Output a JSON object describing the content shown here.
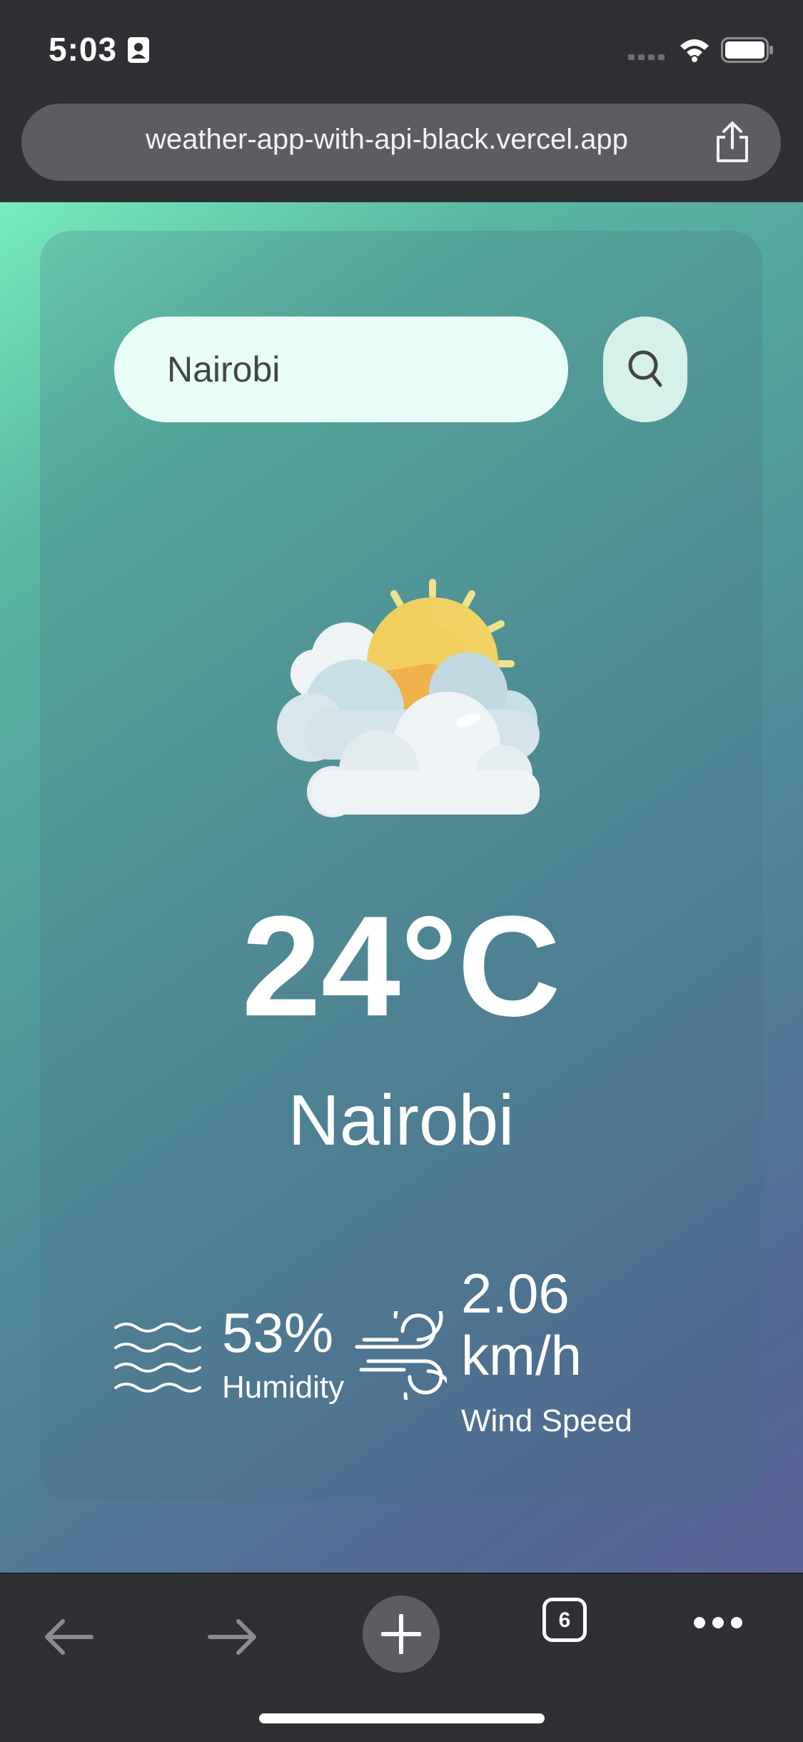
{
  "status_bar": {
    "time": "5:03",
    "icons": [
      "contact-card-icon",
      "cellular-signal-icon",
      "wifi-icon",
      "battery-icon"
    ]
  },
  "browser": {
    "url": "weather-app-with-api-black.vercel.app",
    "share_icon": "share-icon",
    "tab_count": "6",
    "toolbar_icons": [
      "back-arrow-icon",
      "forward-arrow-icon",
      "plus-icon",
      "tabs-icon",
      "more-icon"
    ]
  },
  "app": {
    "search": {
      "value": "Nairobi",
      "icon": "search-icon"
    },
    "weather_icon": "partly-cloudy-icon",
    "temperature": "24°C",
    "city": "Nairobi",
    "humidity": {
      "value": "53%",
      "label": "Humidity",
      "icon": "humidity-waves-icon"
    },
    "wind": {
      "value": "2.06 km/h",
      "label": "Wind Speed",
      "icon": "wind-icon"
    }
  },
  "colors": {
    "gradient_start": "#76ecbd",
    "gradient_mid": "#4f8b98",
    "gradient_end": "#5a6497",
    "browser_chrome": "#2f3034",
    "search_field": "#e9fdf8"
  }
}
